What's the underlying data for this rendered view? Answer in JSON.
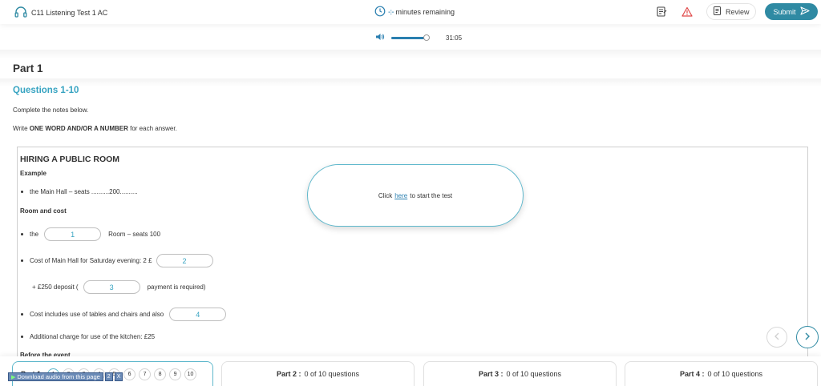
{
  "header": {
    "title": "C11 Listening Test 1 AC",
    "timer_text": "minutes remaining",
    "timer_placeholder": "-:-",
    "review_label": "Review",
    "submit_label": "Submit"
  },
  "audio": {
    "time": "31:05",
    "volume_level": 0.92
  },
  "part_title": "Part 1",
  "questions_title": "Questions 1-10",
  "instructions": {
    "line1": "Complete the notes below.",
    "line2_prefix": "Write",
    "line2_bold": "ONE WORD AND/OR A NUMBER",
    "line2_suffix": "for each answer."
  },
  "notes": {
    "title": "HIRING A PUBLIC ROOM",
    "example_heading": "Example",
    "example_line": "the Main Hall – seats ..........200..........",
    "room_cost_heading": "Room and cost",
    "q1_pre": "the",
    "q1_num": "1",
    "q1_post": "Room – seats 100",
    "q2_pre": "Cost of Main Hall for Saturday evening: 2 £",
    "q2_num": "2",
    "q3_pre": "+ £250 deposit (",
    "q3_num": "3",
    "q3_post": "payment is required)",
    "q4_pre": "Cost includes use of tables and chairs and also",
    "q4_num": "4",
    "kitchen_line": "Additional charge for use of the kitchen: £25",
    "before_event_heading": "Before the event"
  },
  "modal": {
    "prefix": "Click",
    "link": "here",
    "suffix": "to start the test"
  },
  "footer": {
    "part1_label": "Part 1",
    "part1_numbers": [
      "1",
      "2",
      "3",
      "4",
      "5",
      "6",
      "7",
      "8",
      "9",
      "10"
    ],
    "part2_label": "Part 2 :",
    "part2_count": "0 of 10 questions",
    "part3_label": "Part 3 :",
    "part3_count": "0 of 10 questions",
    "part4_label": "Part 4 :",
    "part4_count": "0 of 10 questions"
  },
  "download_bar": {
    "label": "Download audio from this page",
    "small1": "2",
    "small2": "X"
  },
  "colors": {
    "accent": "#2f8aa3",
    "teal_text": "#36a3c1",
    "link": "#2a7fb0",
    "warning": "#e04848"
  },
  "icons": {
    "headphones": "headphones-icon",
    "clock": "clock-icon",
    "notes": "notes-icon",
    "warning": "warning-icon",
    "review": "review-icon",
    "send": "send-icon",
    "volume": "volume-icon",
    "prev": "chevron-left-icon",
    "next": "chevron-right-icon"
  }
}
